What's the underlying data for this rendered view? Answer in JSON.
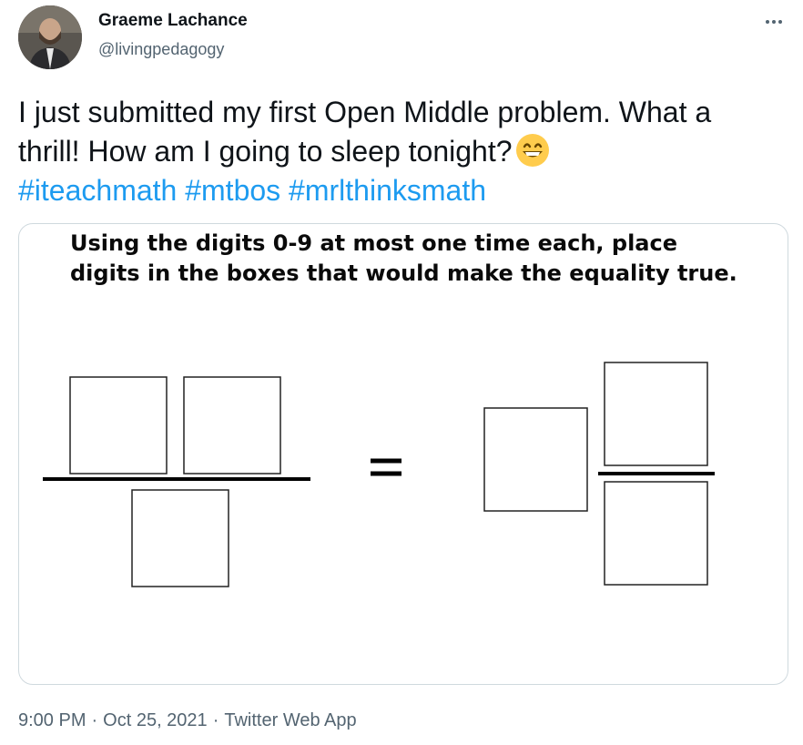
{
  "author": {
    "name": "Graeme Lachance",
    "handle": "@livingpedagogy",
    "avatar_icon": "profile-photo"
  },
  "more_icon": "more-options-icon",
  "tweet": {
    "line1": "I just submitted my first Open Middle problem. What a",
    "line2": "thrill! How am I going to sleep tonight?",
    "emoji": "grinning-face-with-smiling-eyes",
    "hashtags": [
      "#iteachmath",
      "#mtbos",
      "#mrlthinksmath"
    ]
  },
  "media": {
    "instruction_line1": "Using the digits 0-9 at most one time each, place",
    "instruction_line2": "digits in the boxes that would make the equality true.",
    "equals_sign": "="
  },
  "meta": {
    "time": "9:00 PM",
    "date": "Oct 25, 2021",
    "separator": "·",
    "source": "Twitter Web App"
  },
  "colors": {
    "link": "#1d9bf0",
    "secondary_text": "#536471",
    "border": "#cfd9de"
  }
}
